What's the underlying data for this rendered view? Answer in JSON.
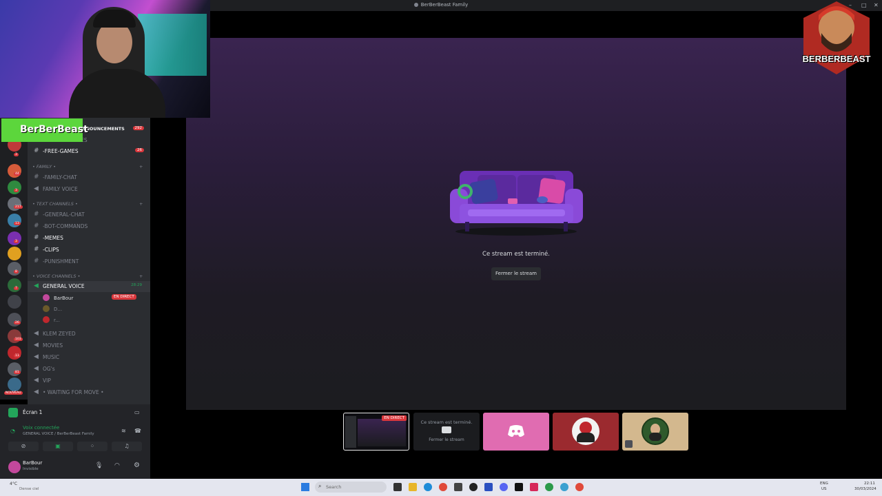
{
  "window": {
    "title": "BerBerBeast Family"
  },
  "stage": {
    "ended_message": "Ce stream est terminé.",
    "close_button": "Fermer le stream"
  },
  "thumbnails": [
    {
      "live_badge": "EN DIRECT"
    },
    {
      "title": "Ce stream est terminé.",
      "action": "Fermer le stream"
    },
    {
      "name": "discord"
    },
    {
      "name": "avatar-red"
    },
    {
      "name": "avatar-green"
    }
  ],
  "overlay": {
    "brand_name": "BerBerBeast",
    "logo_text": "BERBERBEAST"
  },
  "servers": {
    "badges": [
      "3",
      "44",
      "3",
      "217",
      "13",
      "3",
      "8",
      "7",
      "26",
      "103",
      "11",
      "81"
    ],
    "new_label": "NOUVEAU"
  },
  "channels": {
    "announcements": {
      "label": "ANNOUNCEMENTS",
      "badge": "292"
    },
    "discord_rules": "-DISCORD-RULES",
    "free_games": {
      "label": "-FREE-GAMES",
      "badge": "26"
    },
    "family_category": "• FAMILY •",
    "family_chat": "-FAMILY-CHAT",
    "family_voice": "FAMILY VOICE",
    "text_category": "• TEXT CHANNELS •",
    "general_chat": "-GENERAL-CHAT",
    "bot_commands": "-BOT-COMMANDS",
    "memes": "-MEMES",
    "clips": "-CLIPS",
    "punishment": "-PUNISHMENT",
    "voice_category": "• VOICE CHANNELS •",
    "general_voice": {
      "label": "GENERAL VOICE",
      "timer": "28:29"
    },
    "voice_users": [
      {
        "name": "BarBour",
        "badge": "EN DIRECT"
      },
      {
        "name": "D..."
      },
      {
        "name": "r..."
      }
    ],
    "klem_zeyed": "KLEM ZEYED",
    "movies": "MOVIES",
    "music": "MUSIC",
    "ogs": "OG's",
    "vip": "VIP",
    "waiting": "• WAITING FOR MOVE •"
  },
  "screen_panel": {
    "label": "Écran 1"
  },
  "voice_panel": {
    "status": "Voix connectée",
    "location": "GENERAL VOICE / BerBerBeast Family"
  },
  "user": {
    "name": "BarBour",
    "status": "Invisible"
  },
  "taskbar": {
    "weather_temp": "4°C",
    "weather_desc": "Dense ciel",
    "search_placeholder": "Search",
    "lang_top": "ENG",
    "lang_bottom": "US",
    "time": "22:11",
    "date": "30/03/2024"
  },
  "colors": {
    "accent_live": "#da373c",
    "stage_top": "#3a2450",
    "couch": "#7a3fc4"
  }
}
